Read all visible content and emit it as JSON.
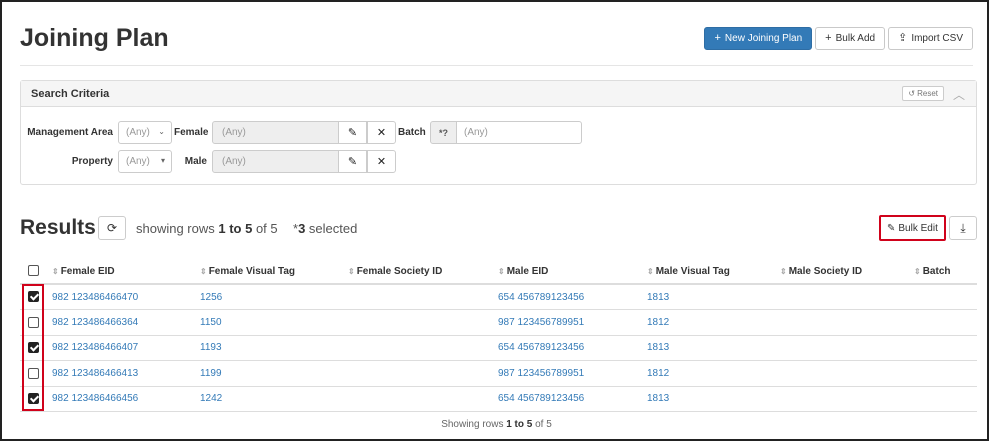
{
  "page": {
    "title": "Joining Plan",
    "actions": {
      "new_label": "New Joining Plan",
      "bulk_add_label": "Bulk Add",
      "import_label": "Import CSV"
    }
  },
  "search": {
    "title": "Search Criteria",
    "reset_label": "Reset",
    "management_area": {
      "label": "Management Area",
      "value": "(Any)"
    },
    "property": {
      "label": "Property",
      "value": "(Any)"
    },
    "female": {
      "label": "Female",
      "placeholder": "(Any)"
    },
    "male": {
      "label": "Male",
      "placeholder": "(Any)"
    },
    "batch": {
      "label": "Batch",
      "addon": "*?",
      "placeholder": "(Any)"
    }
  },
  "results": {
    "title": "Results",
    "showing_prefix": "showing rows ",
    "showing_range": "1 to 5",
    "showing_of": " of 5",
    "selected_prefix": "*",
    "selected_count": "3",
    "selected_suffix": " selected",
    "bulk_edit_label": "Bulk Edit",
    "columns": [
      "Female EID",
      "Female Visual Tag",
      "Female Society ID",
      "Male EID",
      "Male Visual Tag",
      "Male Society ID",
      "Batch"
    ],
    "rows": [
      {
        "checked": true,
        "female_eid": "982 123486466470",
        "female_tag": "1256",
        "female_society": "",
        "male_eid": "654 456789123456",
        "male_tag": "1813",
        "male_society": "",
        "batch": ""
      },
      {
        "checked": false,
        "female_eid": "982 123486466364",
        "female_tag": "1150",
        "female_society": "",
        "male_eid": "987 123456789951",
        "male_tag": "1812",
        "male_society": "",
        "batch": ""
      },
      {
        "checked": true,
        "female_eid": "982 123486466407",
        "female_tag": "1193",
        "female_society": "",
        "male_eid": "654 456789123456",
        "male_tag": "1813",
        "male_society": "",
        "batch": ""
      },
      {
        "checked": false,
        "female_eid": "982 123486466413",
        "female_tag": "1199",
        "female_society": "",
        "male_eid": "987 123456789951",
        "male_tag": "1812",
        "male_society": "",
        "batch": ""
      },
      {
        "checked": true,
        "female_eid": "982 123486466456",
        "female_tag": "1242",
        "female_society": "",
        "male_eid": "654 456789123456",
        "male_tag": "1813",
        "male_society": "",
        "batch": ""
      }
    ],
    "footer_prefix": "Showing rows ",
    "footer_range": "1 to 5",
    "footer_of": " of 5"
  },
  "icons": {
    "plus": "+",
    "upload": "⇪",
    "undo": "↺",
    "chevron_up": "︿",
    "pencil": "✎",
    "times": "✕",
    "refresh": "⟳",
    "edit": "✎",
    "download": "⤓",
    "sort": "⇕"
  },
  "colors": {
    "primary": "#337ab7",
    "highlight": "#d0021b"
  }
}
